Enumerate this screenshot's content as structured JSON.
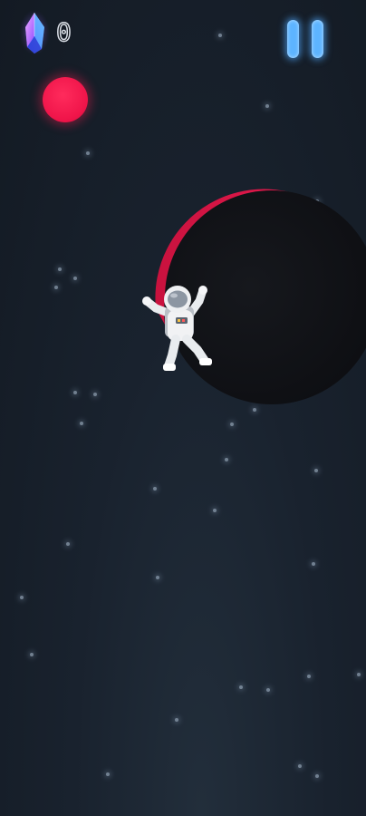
{
  "hud": {
    "gem_count": "0",
    "gem_icon": "crystal-gem-icon",
    "pause_icon": "pause-icon",
    "pause_color": "#5db4ff"
  },
  "scene": {
    "orb_color": "#f0154a",
    "planet_rim_color": "#e0184a",
    "background_color": "#19222e"
  }
}
